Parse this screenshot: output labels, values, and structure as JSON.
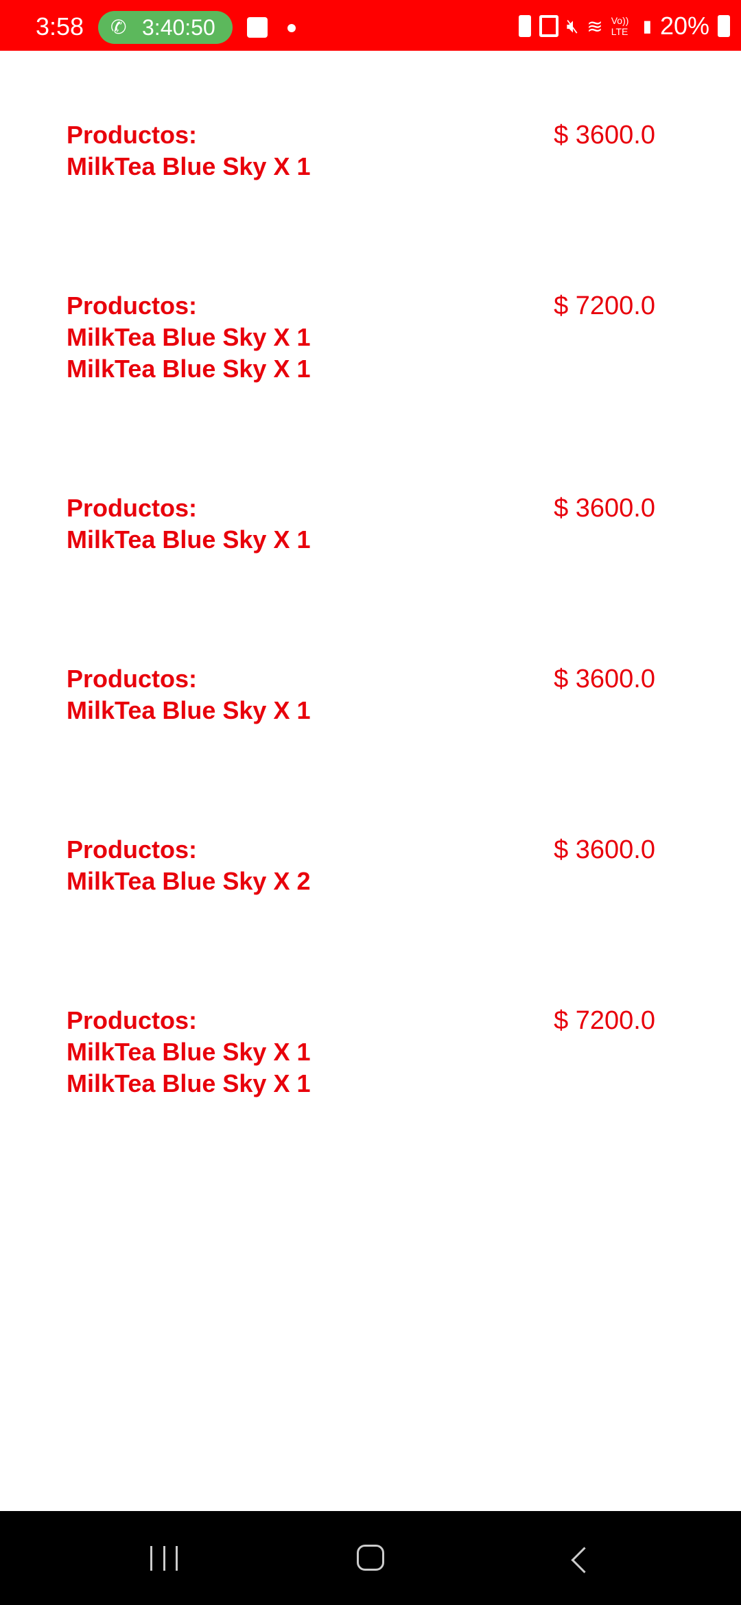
{
  "status_bar": {
    "time": "3:58",
    "call_timer": "3:40:50",
    "battery": "20%",
    "network_label": "Vo)) LTE",
    "color": "#ff0000"
  },
  "orders": [
    {
      "header": "Productos:",
      "products": [
        "MilkTea Blue Sky X 1"
      ],
      "price": "$ 3600.0"
    },
    {
      "header": "Productos:",
      "products": [
        "MilkTea Blue Sky X 1",
        "MilkTea Blue Sky X 1"
      ],
      "price": "$ 7200.0"
    },
    {
      "header": "Productos:",
      "products": [
        "MilkTea Blue Sky X 1"
      ],
      "price": "$ 3600.0"
    },
    {
      "header": "Productos:",
      "products": [
        "MilkTea Blue Sky X 1"
      ],
      "price": "$ 3600.0"
    },
    {
      "header": "Productos:",
      "products": [
        "MilkTea Blue Sky X 2"
      ],
      "price": "$ 3600.0"
    },
    {
      "header": "Productos:",
      "products": [
        "MilkTea Blue Sky X 1",
        "MilkTea Blue Sky X 1"
      ],
      "price": "$ 7200.0"
    }
  ],
  "accent_color": "#e8000b"
}
